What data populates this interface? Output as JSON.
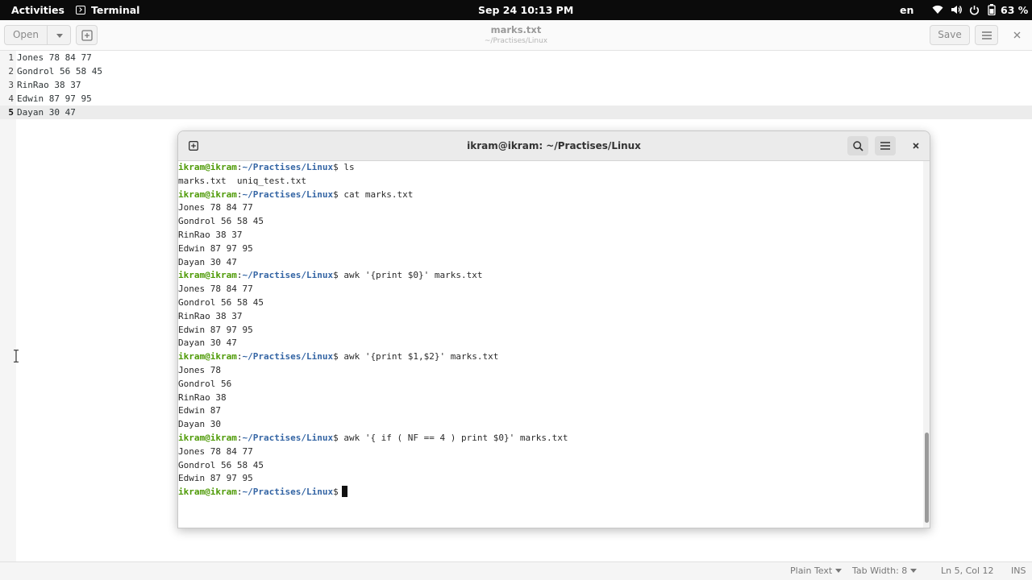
{
  "topbar": {
    "activities": "Activities",
    "app_name": "Terminal",
    "datetime": "Sep 24  10:13 PM",
    "language": "en",
    "battery": "63 %"
  },
  "gedit": {
    "open_label": "Open",
    "title": "marks.txt",
    "subtitle": "~/Practises/Linux",
    "save_label": "Save",
    "lines": [
      {
        "num": "1",
        "text": "Jones 78 84 77"
      },
      {
        "num": "2",
        "text": "Gondrol 56 58 45"
      },
      {
        "num": "3",
        "text": "RinRao 38 37"
      },
      {
        "num": "4",
        "text": "Edwin 87 97 95"
      },
      {
        "num": "5",
        "text": "Dayan 30 47"
      }
    ],
    "current_line": 5,
    "status": {
      "language": "Plain Text",
      "tab_width": "Tab Width: 8",
      "position": "Ln 5, Col 12",
      "mode": "INS"
    }
  },
  "terminal": {
    "title": "ikram@ikram: ~/Practises/Linux",
    "prompt_user": "ikram@ikram",
    "prompt_path": "~/Practises/Linux",
    "lines": [
      {
        "type": "cmd",
        "text": " ls"
      },
      {
        "type": "out",
        "text": "marks.txt  uniq_test.txt"
      },
      {
        "type": "cmd",
        "text": " cat marks.txt"
      },
      {
        "type": "out",
        "text": "Jones 78 84 77"
      },
      {
        "type": "out",
        "text": "Gondrol 56 58 45"
      },
      {
        "type": "out",
        "text": "RinRao 38 37"
      },
      {
        "type": "out",
        "text": "Edwin 87 97 95"
      },
      {
        "type": "out",
        "text": "Dayan 30 47"
      },
      {
        "type": "cmd",
        "text": " awk '{print $0}' marks.txt"
      },
      {
        "type": "out",
        "text": "Jones 78 84 77"
      },
      {
        "type": "out",
        "text": "Gondrol 56 58 45"
      },
      {
        "type": "out",
        "text": "RinRao 38 37"
      },
      {
        "type": "out",
        "text": "Edwin 87 97 95"
      },
      {
        "type": "out",
        "text": "Dayan 30 47"
      },
      {
        "type": "cmd",
        "text": " awk '{print $1,$2}' marks.txt"
      },
      {
        "type": "out",
        "text": "Jones 78"
      },
      {
        "type": "out",
        "text": "Gondrol 56"
      },
      {
        "type": "out",
        "text": "RinRao 38"
      },
      {
        "type": "out",
        "text": "Edwin 87"
      },
      {
        "type": "out",
        "text": "Dayan 30"
      },
      {
        "type": "cmd",
        "text": " awk '{ if ( NF == 4 ) print $0}' marks.txt"
      },
      {
        "type": "out",
        "text": "Jones 78 84 77"
      },
      {
        "type": "out",
        "text": "Gondrol 56 58 45"
      },
      {
        "type": "out",
        "text": "Edwin 87 97 95"
      },
      {
        "type": "prompt",
        "text": " "
      }
    ]
  },
  "colors": {
    "prompt_user": "#4e9a06",
    "prompt_path": "#3465a4",
    "topbar_bg": "#0b0b0b"
  },
  "icons": {
    "terminal_app": "terminal-icon",
    "new_tab": "new-tab-icon",
    "search": "search-icon",
    "menu": "hamburger-menu-icon",
    "close": "close-icon",
    "wifi": "wifi-icon",
    "volume": "volume-icon",
    "power": "power-icon",
    "battery": "battery-icon"
  }
}
